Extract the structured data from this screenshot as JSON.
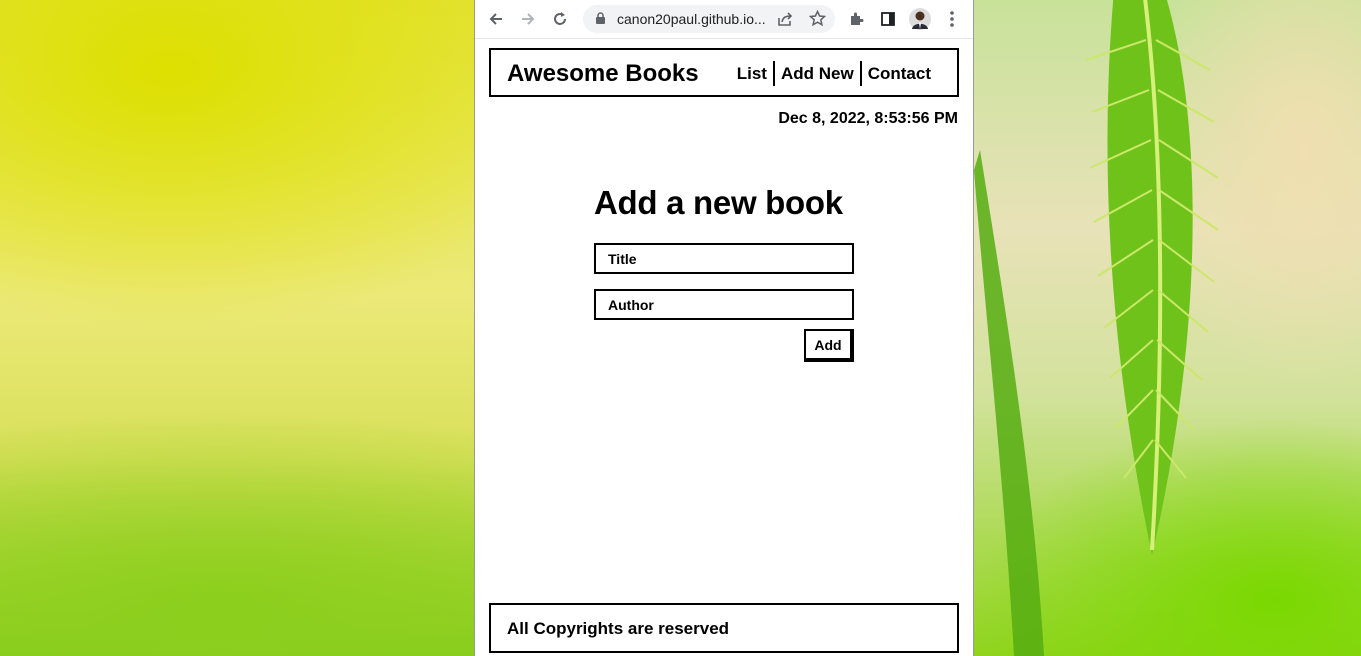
{
  "browser": {
    "url": "canon20paul.github.io...",
    "icons": [
      "back-icon",
      "forward-icon",
      "reload-icon",
      "lock-icon",
      "share-icon",
      "star-icon",
      "extensions-icon",
      "side-panel-icon",
      "profile-avatar",
      "menu-icon"
    ]
  },
  "header": {
    "logo": "Awesome Books",
    "nav": [
      "List",
      "Add New",
      "Contact"
    ]
  },
  "datetime": "Dec 8, 2022, 8:53:56 PM",
  "form": {
    "heading": "Add a new book",
    "title_placeholder": "Title",
    "author_placeholder": "Author",
    "add_label": "Add"
  },
  "footer": {
    "text": "All Copyrights are reserved"
  }
}
